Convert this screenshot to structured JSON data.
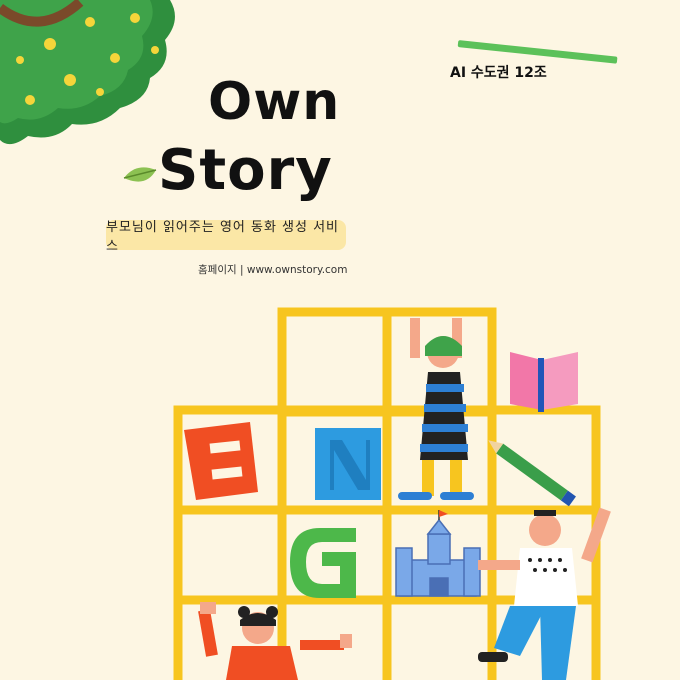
{
  "title": {
    "line1": "Own",
    "line2": "Story"
  },
  "subtitle": "부모님이 읽어주는 영어 동화 생성 서비스",
  "homepage": "홈페이지 | www.ownstory.com",
  "team": "AI 수도권 12조",
  "colors": {
    "background": "#fdf6e3",
    "shelf": "#f7c51f",
    "accent_green": "#5cc15a",
    "letter_e": "#f04e23",
    "letter_n": "#2d9be0",
    "letter_g": "#4db84a",
    "book": "#f277a8",
    "subtitle_pill": "#fbe7a6"
  },
  "icons": [
    "tree-canopy-icon",
    "leaf-icon",
    "letter-e-block",
    "letter-n-block",
    "letter-g-block",
    "open-book-icon",
    "pencil-icon",
    "castle-icon",
    "child-figures"
  ]
}
